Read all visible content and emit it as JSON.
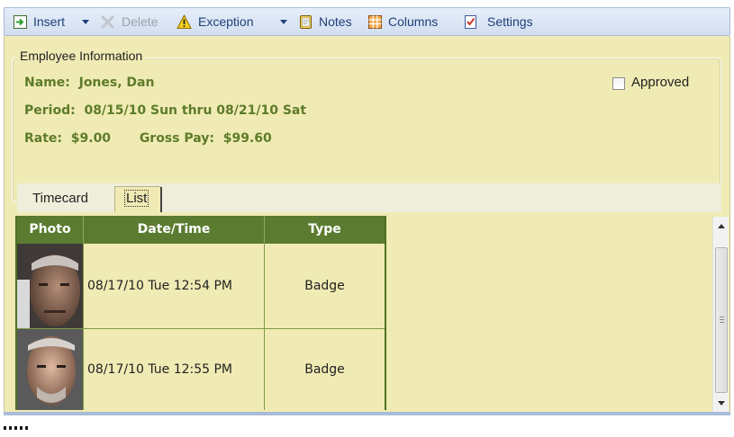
{
  "toolbar": {
    "insert": "Insert",
    "delete": "Delete",
    "exception": "Exception",
    "notes": "Notes",
    "columns": "Columns",
    "settings": "Settings"
  },
  "employee_info": {
    "legend": "Employee Information",
    "name_label": "Name:",
    "name_value": "Jones, Dan",
    "period_label": "Period:",
    "period_value": "08/15/10 Sun thru 08/21/10 Sat",
    "rate_label": "Rate:",
    "rate_value": "$9.00",
    "gross_label": "Gross Pay:",
    "gross_value": "$99.60",
    "approved_label": "Approved",
    "approved_checked": false
  },
  "tabs": [
    {
      "label": "Timecard",
      "selected": false
    },
    {
      "label": "List",
      "selected": true
    }
  ],
  "grid": {
    "columns": [
      "Photo",
      "Date/Time",
      "Type"
    ],
    "rows": [
      {
        "datetime": "08/17/10 Tue 12:54 PM",
        "type": "Badge"
      },
      {
        "datetime": "08/17/10 Tue 12:55 PM",
        "type": "Badge"
      }
    ]
  },
  "colors": {
    "panel_bg": "#f0ebb4",
    "grid_header_bg": "#5b7b30",
    "label_green": "#5e7b2a",
    "toolbar_text": "#1e3f78"
  }
}
